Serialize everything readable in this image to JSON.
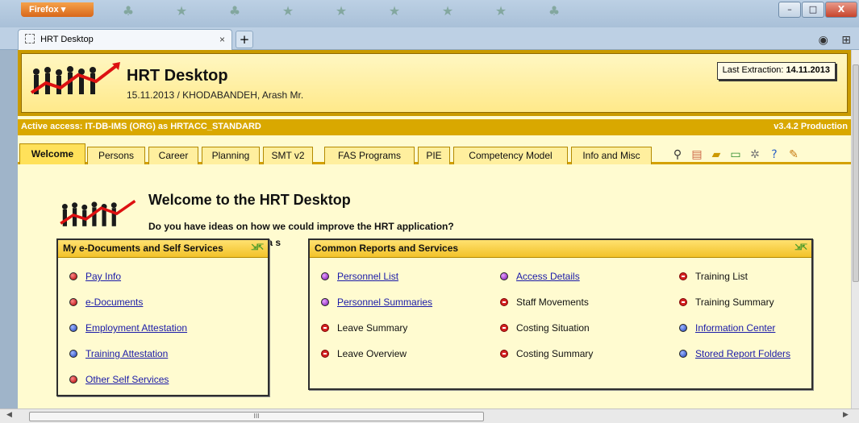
{
  "browser": {
    "menu_label": "Firefox ▾",
    "tab_title": "HRT Desktop",
    "tab_close": "×",
    "new_tab": "+",
    "min": "–",
    "max": "□",
    "close": "X",
    "right_tools": "◉ ⊞"
  },
  "header": {
    "title": "HRT Desktop",
    "subtitle": "15.11.2013 / KHODABANDEH, Arash Mr.",
    "extraction_label": "Last Extraction: ",
    "extraction_date": "14.11.2013"
  },
  "access": {
    "text": "Active access: IT-DB-IMS (ORG) as HRTACC_STANDARD",
    "version": "v3.4.2 Production"
  },
  "tabs": [
    {
      "label": "Welcome"
    },
    {
      "label": "Persons"
    },
    {
      "label": "Career"
    },
    {
      "label": "Planning"
    },
    {
      "label": "SMT v2"
    },
    {
      "label": "FAS Programs"
    },
    {
      "label": "PIE"
    },
    {
      "label": "Competency Model"
    },
    {
      "label": "Info and Misc"
    }
  ],
  "welcome": {
    "title": "Welcome to the HRT Desktop",
    "question": "Do you have ideas on how we could improve the HRT application?",
    "fragment": "ost a s"
  },
  "self_services": {
    "title": "My e-Documents and Self Services",
    "items": [
      {
        "label": "Pay Info",
        "bullet": "red",
        "link": true
      },
      {
        "label": "e-Documents",
        "bullet": "red",
        "link": true
      },
      {
        "label": "Employment Attestation",
        "bullet": "blue",
        "link": true
      },
      {
        "label": "Training Attestation",
        "bullet": "blue",
        "link": true
      },
      {
        "label": "Other Self Services",
        "bullet": "red",
        "link": true
      }
    ]
  },
  "reports": {
    "title": "Common Reports and Services",
    "col1": [
      {
        "label": "Personnel List",
        "bullet": "purple",
        "link": true
      },
      {
        "label": "Personnel Summaries",
        "bullet": "purple",
        "link": true
      },
      {
        "label": "Leave Summary",
        "bullet": "nogo",
        "link": false
      },
      {
        "label": "Leave Overview",
        "bullet": "nogo",
        "link": false
      }
    ],
    "col2": [
      {
        "label": "Access Details",
        "bullet": "purple",
        "link": true
      },
      {
        "label": "Staff Movements",
        "bullet": "nogo",
        "link": false
      },
      {
        "label": "Costing Situation",
        "bullet": "nogo",
        "link": false
      },
      {
        "label": "Costing Summary",
        "bullet": "nogo",
        "link": false
      }
    ],
    "col3": [
      {
        "label": "Training List",
        "bullet": "nogo",
        "link": false
      },
      {
        "label": "Training Summary",
        "bullet": "nogo",
        "link": false
      },
      {
        "label": "Information Center",
        "bullet": "blue",
        "link": true
      },
      {
        "label": "Stored Report Folders",
        "bullet": "blue",
        "link": true
      }
    ]
  },
  "scroll": {
    "hthumb": "III"
  }
}
